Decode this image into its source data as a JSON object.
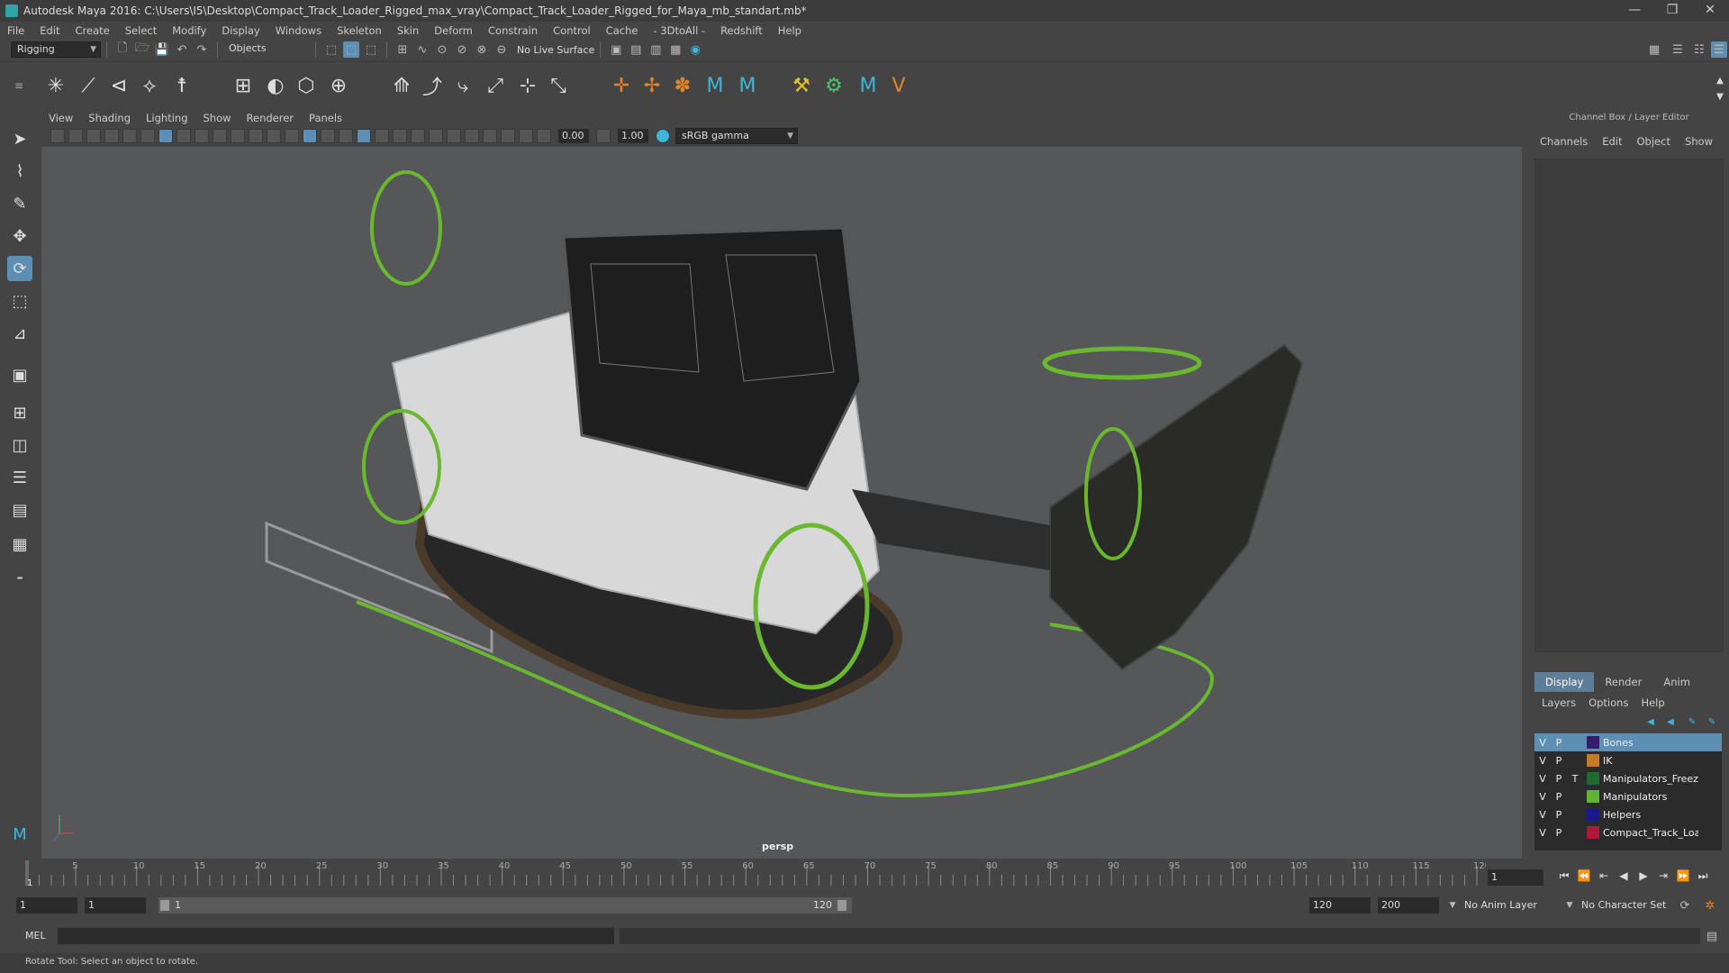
{
  "window": {
    "title": "Autodesk Maya 2016: C:\\Users\\I5\\Desktop\\Compact_Track_Loader_Rigged_max_vray\\Compact_Track_Loader_Rigged_for_Maya_mb_standart.mb*",
    "controls": [
      "—",
      "❐",
      "✕"
    ]
  },
  "menubar": [
    "File",
    "Edit",
    "Create",
    "Select",
    "Modify",
    "Display",
    "Windows",
    "Skeleton",
    "Skin",
    "Deform",
    "Constrain",
    "Control",
    "Cache",
    "- 3DtoAll -",
    "Redshift",
    "Help"
  ],
  "statusline": {
    "menuset": "Rigging",
    "selection_mode": "Objects",
    "live_surface": "No Live Surface"
  },
  "viewport": {
    "menu": [
      "View",
      "Shading",
      "Lighting",
      "Show",
      "Renderer",
      "Panels"
    ],
    "near_value": "0.00",
    "gamma_value": "1.00",
    "colorspace": "sRGB gamma",
    "camera": "persp"
  },
  "channelbox": {
    "title": "Channel Box / Layer Editor",
    "menu": [
      "Channels",
      "Edit",
      "Object",
      "Show"
    ]
  },
  "layer_editor": {
    "tabs": [
      "Display",
      "Render",
      "Anim"
    ],
    "active_tab": "Display",
    "menu": [
      "Layers",
      "Options",
      "Help"
    ],
    "layers": [
      {
        "v": "V",
        "p": "P",
        "t": "",
        "name": "Bones",
        "color": "#3a1a6e",
        "selected": true
      },
      {
        "v": "V",
        "p": "P",
        "t": "",
        "name": "IK",
        "color": "#c87a2a",
        "selected": false
      },
      {
        "v": "V",
        "p": "P",
        "t": "T",
        "name": "Manipulators_Freez",
        "color": "#1f6b2e",
        "selected": false
      },
      {
        "v": "V",
        "p": "P",
        "t": "",
        "name": "Manipulators",
        "color": "#5fb335",
        "selected": false
      },
      {
        "v": "V",
        "p": "P",
        "t": "",
        "name": "Helpers",
        "color": "#1a1a8a",
        "selected": false
      },
      {
        "v": "V",
        "p": "P",
        "t": "",
        "name": "Compact_Track_Loac",
        "color": "#b0183a",
        "selected": false
      }
    ]
  },
  "timeslider": {
    "ticks": [
      1,
      5,
      10,
      15,
      20,
      25,
      30,
      35,
      40,
      45,
      50,
      55,
      60,
      65,
      70,
      75,
      80,
      85,
      90,
      95,
      100,
      105,
      110,
      115,
      120
    ],
    "start": 1,
    "end": 120,
    "current_frame": "1"
  },
  "rangeslider": {
    "start_time": "1",
    "playback_start": "1",
    "range_start": "1",
    "range_end": "120",
    "playback_end": "120",
    "end_time": "200",
    "anim_layer": "No Anim Layer",
    "character_set": "No Character Set"
  },
  "cmdline": {
    "label": "MEL"
  },
  "helpline": {
    "text": "Rotate Tool: Select an object to rotate."
  },
  "colors": {
    "accent": "#5d8fb4",
    "manipulator": "#6ab82f"
  }
}
